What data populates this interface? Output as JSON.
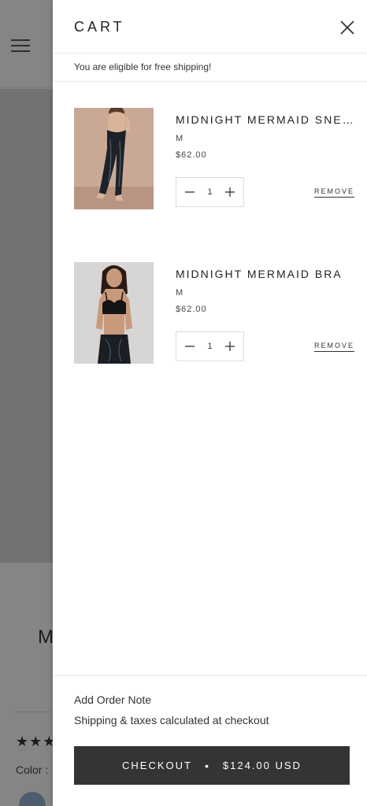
{
  "background": {
    "title_fragment": "M",
    "stars": "★★★",
    "color_label": "Color :"
  },
  "cart": {
    "title": "CART",
    "free_shipping_message": "You are eligible for free shipping!",
    "items": [
      {
        "name": "MIDNIGHT MERMAID SNEA…",
        "variant": "M",
        "price": "$62.00",
        "quantity": "1",
        "remove_label": "REMOVE",
        "image": "leggings-product-photo"
      },
      {
        "name": "MIDNIGHT MERMAID BRA",
        "variant": "M",
        "price": "$62.00",
        "quantity": "1",
        "remove_label": "REMOVE",
        "image": "bra-product-photo"
      }
    ],
    "footer": {
      "order_note_label": "Add Order Note",
      "shipping_taxes_note": "Shipping & taxes calculated at checkout",
      "checkout_label": "CHECKOUT",
      "separator": "•",
      "total": "$124.00 USD"
    }
  },
  "colors": {
    "checkout_bg": "#343434",
    "overlay": "rgba(0,0,0,0.45)"
  }
}
